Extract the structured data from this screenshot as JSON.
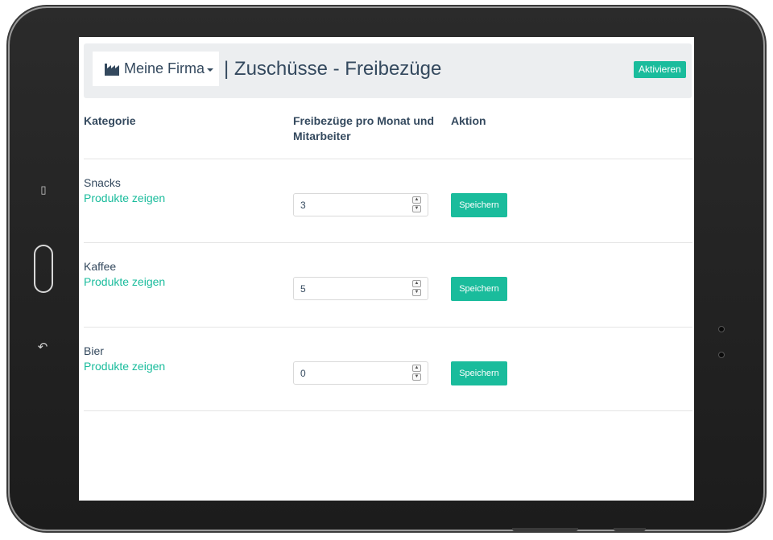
{
  "header": {
    "brand_label": "Meine Firma",
    "brand_icon": "factory-icon",
    "page_title": "| Zuschüsse - Freibezüge",
    "activate_label": "Aktivieren"
  },
  "colors": {
    "accent": "#1abc9c",
    "text": "#34495e",
    "header_bg": "#eceef0"
  },
  "table": {
    "headers": {
      "category": "Kategorie",
      "free_line1": "Freibezüge pro Monat und",
      "free_line2": "Mitarbeiter",
      "action": "Aktion"
    },
    "rows": [
      {
        "category": "Snacks",
        "link": "Produkte zeigen",
        "value": "3",
        "save_label": "Speichern"
      },
      {
        "category": "Kaffee",
        "link": "Produkte zeigen",
        "value": "5",
        "save_label": "Speichern"
      },
      {
        "category": "Bier",
        "link": "Produkte zeigen",
        "value": "0",
        "save_label": "Speichern"
      }
    ]
  }
}
